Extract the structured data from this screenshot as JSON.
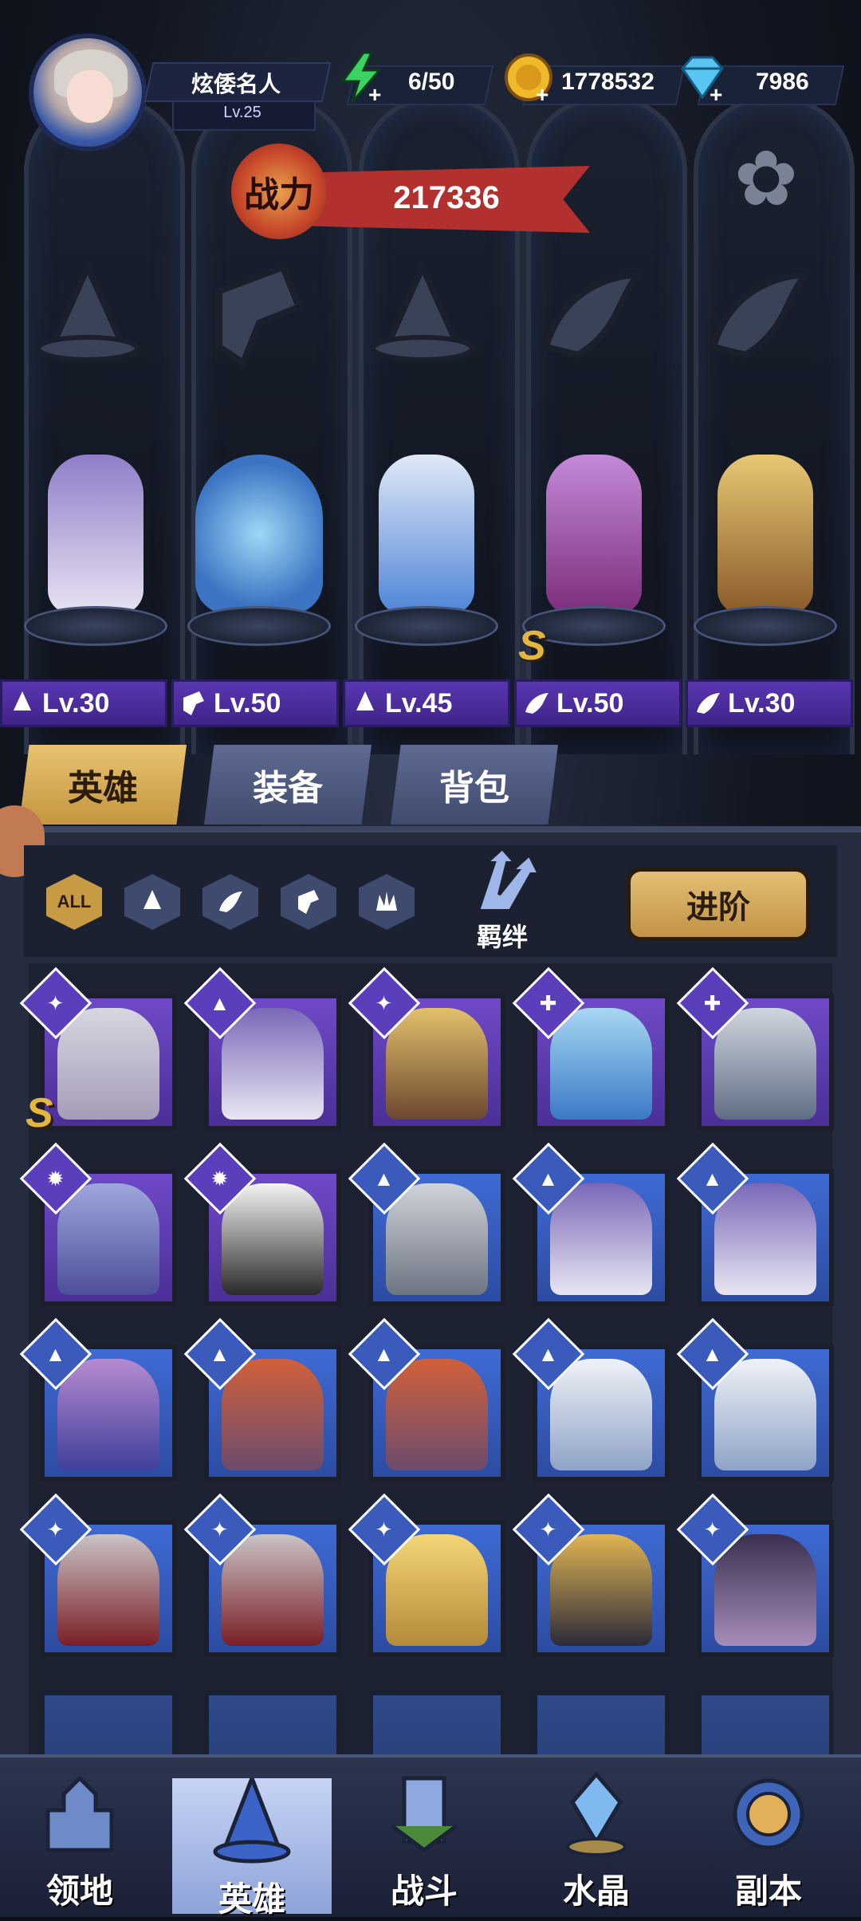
{
  "player": {
    "name": "炫倭名人",
    "level": "Lv.25"
  },
  "resources": {
    "energy": "6/50",
    "gold": "1778532",
    "gems": "7986"
  },
  "power": {
    "label": "战力",
    "value": "217336"
  },
  "lineup": [
    {
      "level": "Lv.30",
      "class_icon": "mage-hat-icon"
    },
    {
      "level": "Lv.50",
      "class_icon": "wrench-icon"
    },
    {
      "level": "Lv.45",
      "class_icon": "mage-hat-icon"
    },
    {
      "level": "Lv.50",
      "class_icon": "wing-icon"
    },
    {
      "level": "Lv.30",
      "class_icon": "wing-icon"
    }
  ],
  "tabs": [
    "英雄",
    "装备",
    "背包"
  ],
  "filters": {
    "all": "ALL",
    "bond": "羁绊"
  },
  "advance_button": "进阶",
  "s_rank": "S",
  "nav": [
    "领地",
    "英雄",
    "战斗",
    "水晶",
    "副本"
  ],
  "colors": {
    "tab_active": "#e3bf74",
    "level_tag": "#5a36b2",
    "card_purple": "#6f49c8",
    "card_blue": "#3f6ad4",
    "power_banner": "#b2302e"
  }
}
